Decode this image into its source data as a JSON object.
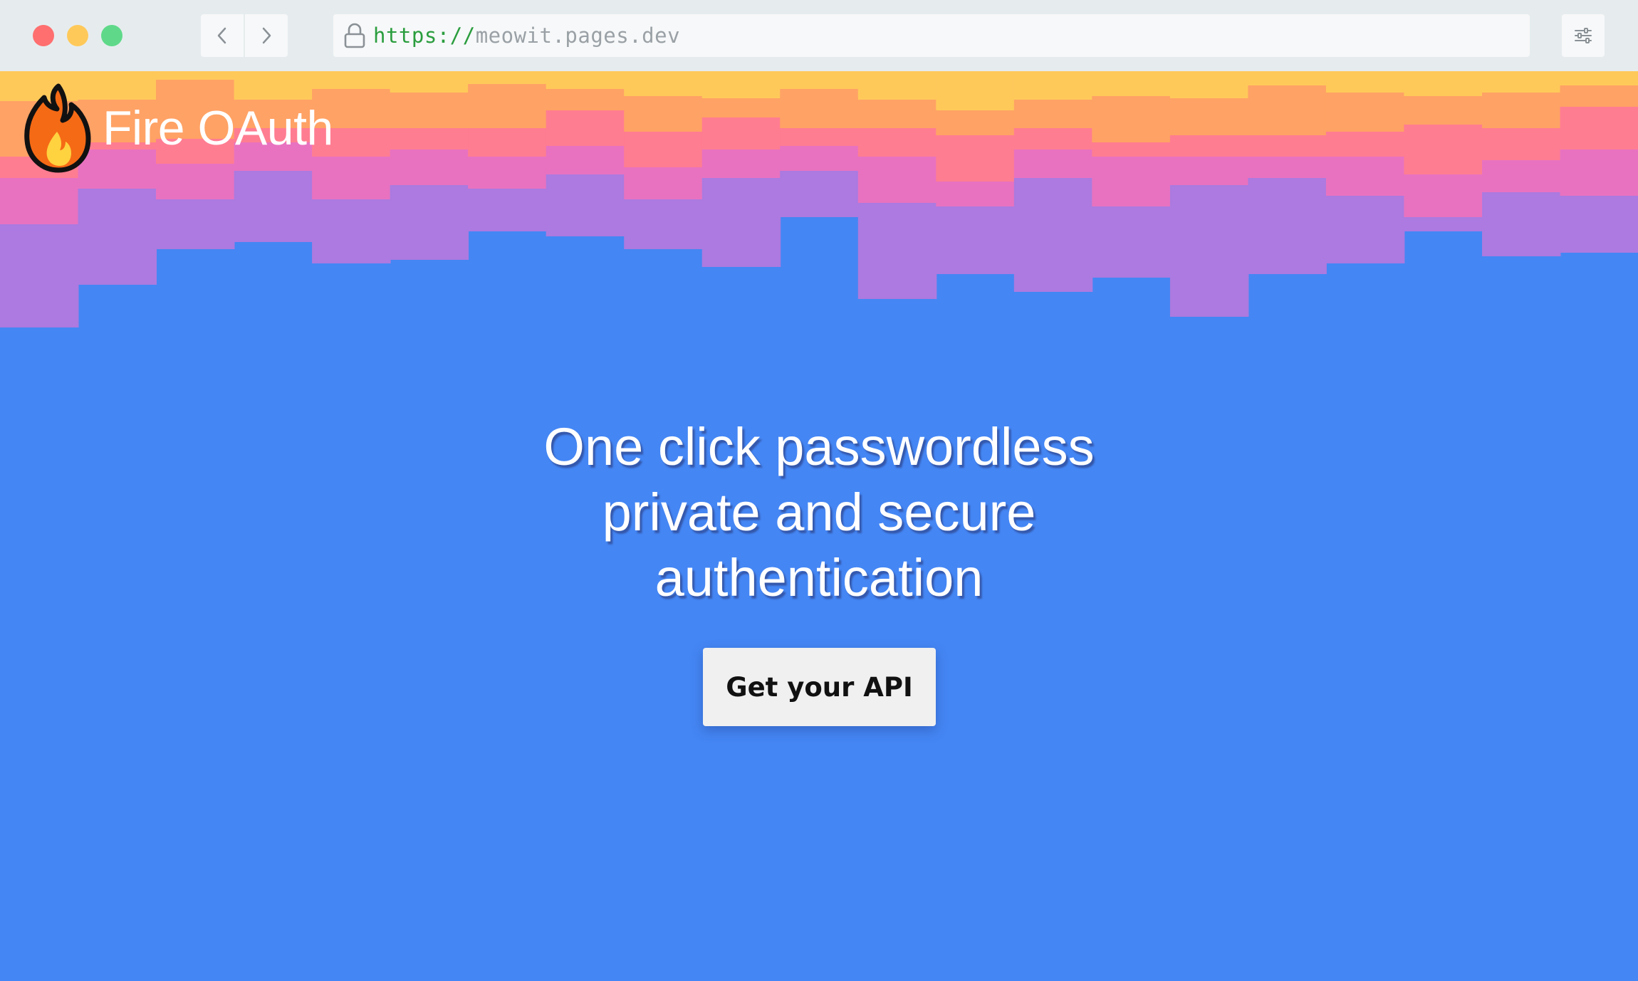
{
  "browser": {
    "url_scheme": "https://",
    "url_host": "meowit.pages.dev",
    "back_icon": "chevron-left-icon",
    "forward_icon": "chevron-right-icon",
    "lock_icon": "lock-icon",
    "menu_icon": "sliders-icon"
  },
  "brand": {
    "name": "Fire OAuth",
    "logo_icon": "fire-icon"
  },
  "hero": {
    "headline_lines": [
      "One click passwordless",
      "private and secure",
      "authentication"
    ],
    "cta_label": "Get your API"
  },
  "colors": {
    "background": "#4486f4",
    "gradient": [
      "#ffc95a",
      "#ffa265",
      "#ff7d91",
      "#e872c0",
      "#ac7ae0",
      "#4486f4"
    ]
  }
}
